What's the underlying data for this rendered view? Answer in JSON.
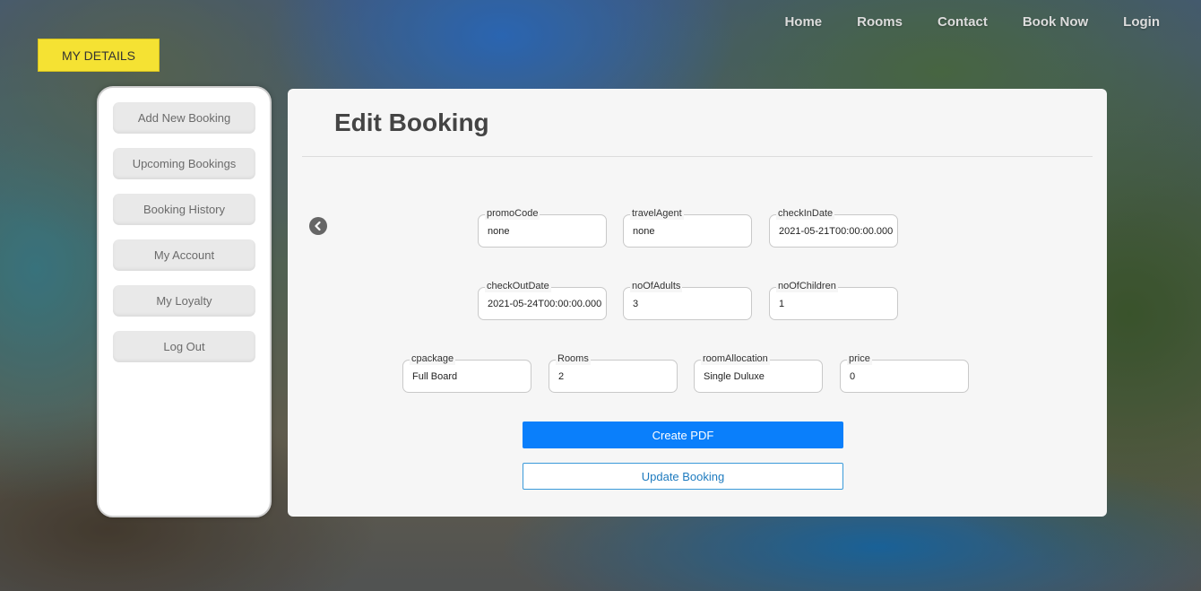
{
  "nav": {
    "items": [
      "Home",
      "Rooms",
      "Contact",
      "Book Now",
      "Login"
    ]
  },
  "my_details_label": "MY DETAILS",
  "sidebar": {
    "items": [
      {
        "label": "Add New Booking"
      },
      {
        "label": "Upcoming Bookings"
      },
      {
        "label": "Booking History"
      },
      {
        "label": "My Account"
      },
      {
        "label": "My Loyalty"
      },
      {
        "label": "Log Out"
      }
    ]
  },
  "main": {
    "title": "Edit Booking",
    "back_icon": "chevron-left-circle-icon",
    "fields": [
      {
        "label": "promoCode",
        "value": "none"
      },
      {
        "label": "travelAgent",
        "value": "none"
      },
      {
        "label": "checkInDate",
        "value": "2021-05-21T00:00:00.000"
      },
      {
        "label": "checkOutDate",
        "value": "2021-05-24T00:00:00.000"
      },
      {
        "label": "noOfAdults",
        "value": "3"
      },
      {
        "label": "noOfChildren",
        "value": "1"
      },
      {
        "label": "cpackage",
        "value": "Full Board"
      },
      {
        "label": "Rooms",
        "value": "2"
      },
      {
        "label": "roomAllocation",
        "value": "Single Duluxe"
      },
      {
        "label": "price",
        "value": "0"
      }
    ],
    "create_pdf_label": "Create PDF",
    "update_booking_label": "Update Booking"
  },
  "colors": {
    "accent_yellow": "#f5e233",
    "primary_blue": "#0a7ffb",
    "outline_blue": "#3a9ad9"
  }
}
